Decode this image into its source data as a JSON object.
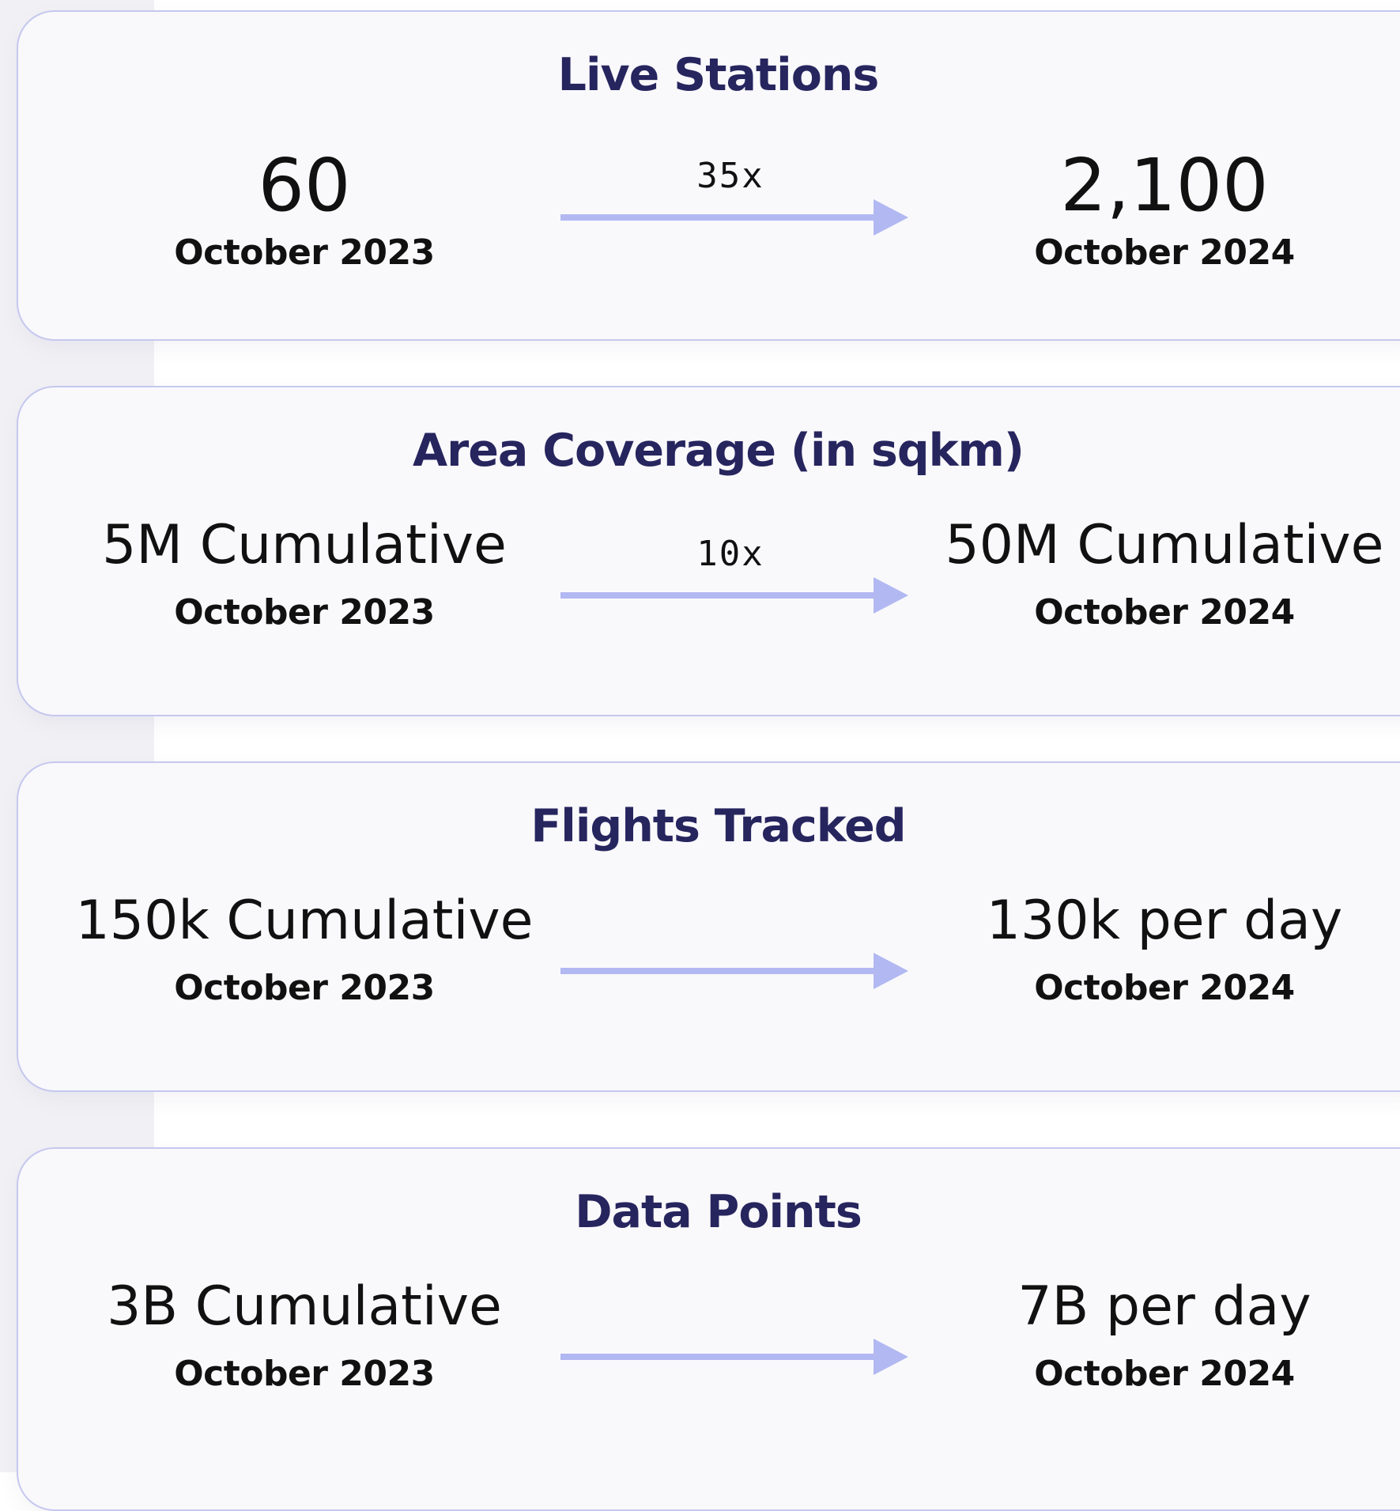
{
  "colors": {
    "title": "#27255e",
    "text": "#111111",
    "arrow": "#b2b8f1",
    "card_background": "#f9f9fc",
    "card_border": "#c5c8ee"
  },
  "cards": [
    {
      "title": "Live Stations",
      "from": {
        "value": "60",
        "date": "October 2023"
      },
      "multiplier": "35x",
      "to": {
        "value": "2,100",
        "date": "October 2024"
      }
    },
    {
      "title": "Area Coverage (in sqkm)",
      "from": {
        "value": "5M Cumulative",
        "date": "October 2023"
      },
      "multiplier": "10x",
      "to": {
        "value": "50M Cumulative",
        "date": "October 2024"
      }
    },
    {
      "title": "Flights Tracked",
      "from": {
        "value": "150k Cumulative",
        "date": "October 2023"
      },
      "multiplier": "",
      "to": {
        "value": "130k per day",
        "date": "October 2024"
      }
    },
    {
      "title": "Data Points",
      "from": {
        "value": "3B Cumulative",
        "date": "October 2023"
      },
      "multiplier": "",
      "to": {
        "value": "7B per day",
        "date": "October 2024"
      }
    }
  ]
}
